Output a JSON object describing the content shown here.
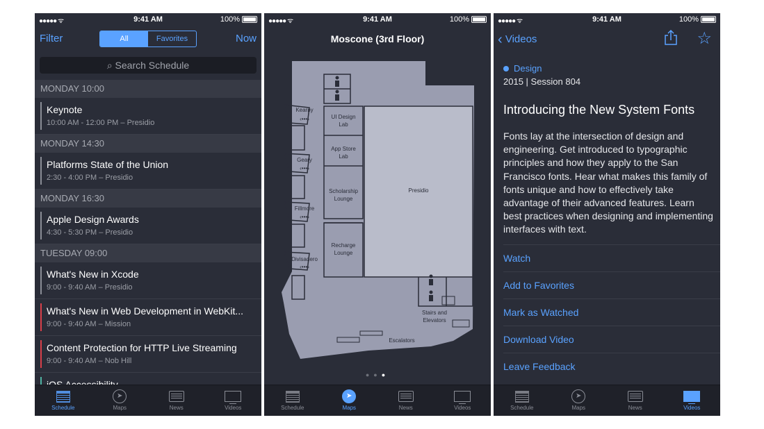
{
  "status": {
    "time": "9:41 AM",
    "battery": "100%",
    "signal": "●●●●● ᯤ"
  },
  "tabs": [
    "Schedule",
    "Maps",
    "News",
    "Videos"
  ],
  "schedule": {
    "filter": "Filter",
    "now": "Now",
    "segments": [
      "All",
      "Favorites"
    ],
    "search_placeholder": "Search Schedule",
    "sections": [
      {
        "header": "MONDAY 10:00",
        "items": [
          {
            "title": "Keynote",
            "sub": "10:00 AM - 12:00 PM – Presidio",
            "color": "#8a8d96"
          }
        ]
      },
      {
        "header": "MONDAY 14:30",
        "items": [
          {
            "title": "Platforms State of the Union",
            "sub": "2:30 - 4:00 PM – Presidio",
            "color": "#8a8d96"
          }
        ]
      },
      {
        "header": "MONDAY 16:30",
        "items": [
          {
            "title": "Apple Design Awards",
            "sub": "4:30 - 5:30 PM – Presidio",
            "color": "#8a8d96"
          }
        ]
      },
      {
        "header": "TUESDAY 09:00",
        "items": [
          {
            "title": "What's New in Xcode",
            "sub": "9:00 - 9:40 AM – Presidio",
            "color": "#8a8d96"
          },
          {
            "title": "What's New in Web Development in WebKit...",
            "sub": "9:00 - 9:40 AM – Mission",
            "color": "#d8404a"
          },
          {
            "title": "Content Protection for HTTP Live Streaming",
            "sub": "9:00 - 9:40 AM – Nob Hill",
            "color": "#d8404a"
          },
          {
            "title": "iOS Accessibility",
            "sub": "",
            "color": "#4fb3a3"
          }
        ]
      }
    ]
  },
  "maps": {
    "title": "Moscone (3rd Floor)",
    "rooms": {
      "kearny": "Kearny",
      "geary": "Geary",
      "fillmore": "Fillmore",
      "divisadero": "Divisadero",
      "ui_lab_1": "UI Design",
      "ui_lab_2": "Lab",
      "appstore_1": "App Store",
      "appstore_2": "Lab",
      "scholar_1": "Scholarship",
      "scholar_2": "Lounge",
      "presidio": "Presidio",
      "recharge_1": "Recharge",
      "recharge_2": "Lounge",
      "stairs_1": "Stairs and",
      "stairs_2": "Elevators",
      "escalators": "Escalators"
    },
    "door_glyph": "‹•••›",
    "page_dots": "● ● ●",
    "current_page": 3,
    "page_count": 3
  },
  "video": {
    "back": "Videos",
    "track": "Design",
    "session": "2015 | Session 804",
    "title": "Introducing the New System Fonts",
    "description": "Fonts lay at the intersection of design and engineering. Get introduced to typographic principles and how they apply to the San Francisco fonts. Hear what makes this family of fonts unique and how to effectively take advantage of their advanced features. Learn best practices when designing and implementing interfaces with text.",
    "actions": [
      "Watch",
      "Add to Favorites",
      "Mark as Watched",
      "Download Video",
      "Leave Feedback"
    ]
  },
  "colors": {
    "accent": "#5aa2ff",
    "background": "#2a2d38",
    "map": "#9a9db0",
    "room": "#b9bcca"
  }
}
